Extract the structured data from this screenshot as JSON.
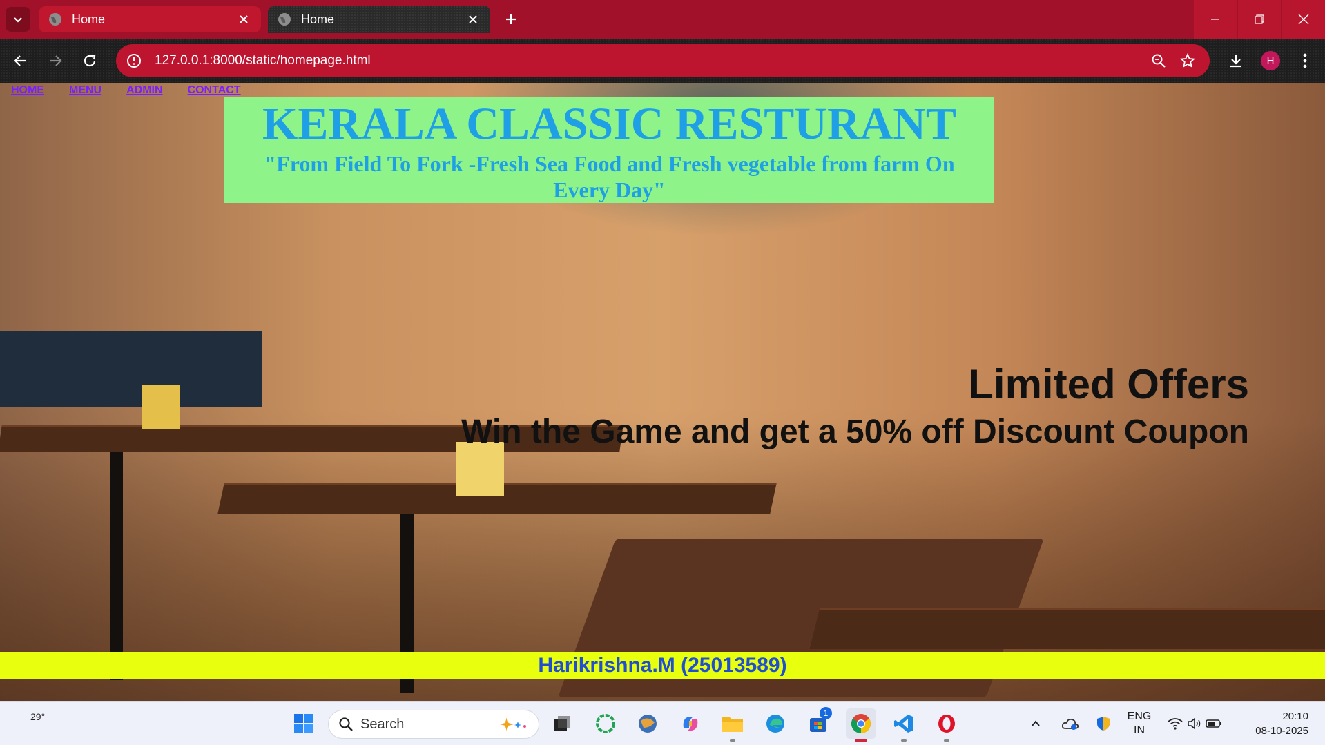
{
  "browser": {
    "tabs": [
      {
        "title": "Home",
        "active": false
      },
      {
        "title": "Home",
        "active": true
      }
    ],
    "url": "127.0.0.1:8000/static/homepage.html",
    "profile_initial": "H",
    "accent_color": "#a11129"
  },
  "page": {
    "nav": [
      "HOME",
      "MENU",
      "ADMIN",
      "CONTACT"
    ],
    "hero": {
      "title": "KERALA CLASSIC RESTURANT",
      "tagline": "\"From Field To Fork -Fresh Sea Food and Fresh vegetable from farm On Every Day\""
    },
    "offer": {
      "title": "Limited Offers",
      "subtitle": "Win the Game and get a 50% off Discount Coupon"
    },
    "footer": "Harikrishna.M (25013589)",
    "colors": {
      "hero_bg": "#8ef48a",
      "hero_text": "#1fa0e6",
      "footer_bg": "#e8ff0e",
      "footer_text": "#1f4fd0"
    }
  },
  "taskbar": {
    "weather": "29°",
    "search_placeholder": "Search",
    "apps": [
      "start-icon",
      "task-view-icon",
      "copilot-ring-icon",
      "browser-app-icon",
      "copilot-icon",
      "file-explorer-icon",
      "edge-icon",
      "store-icon",
      "chrome-icon",
      "vscode-icon",
      "opera-icon"
    ],
    "store_badge": "1",
    "lang_top": "ENG",
    "lang_bottom": "IN",
    "time": "20:10",
    "date": "08-10-2025"
  }
}
